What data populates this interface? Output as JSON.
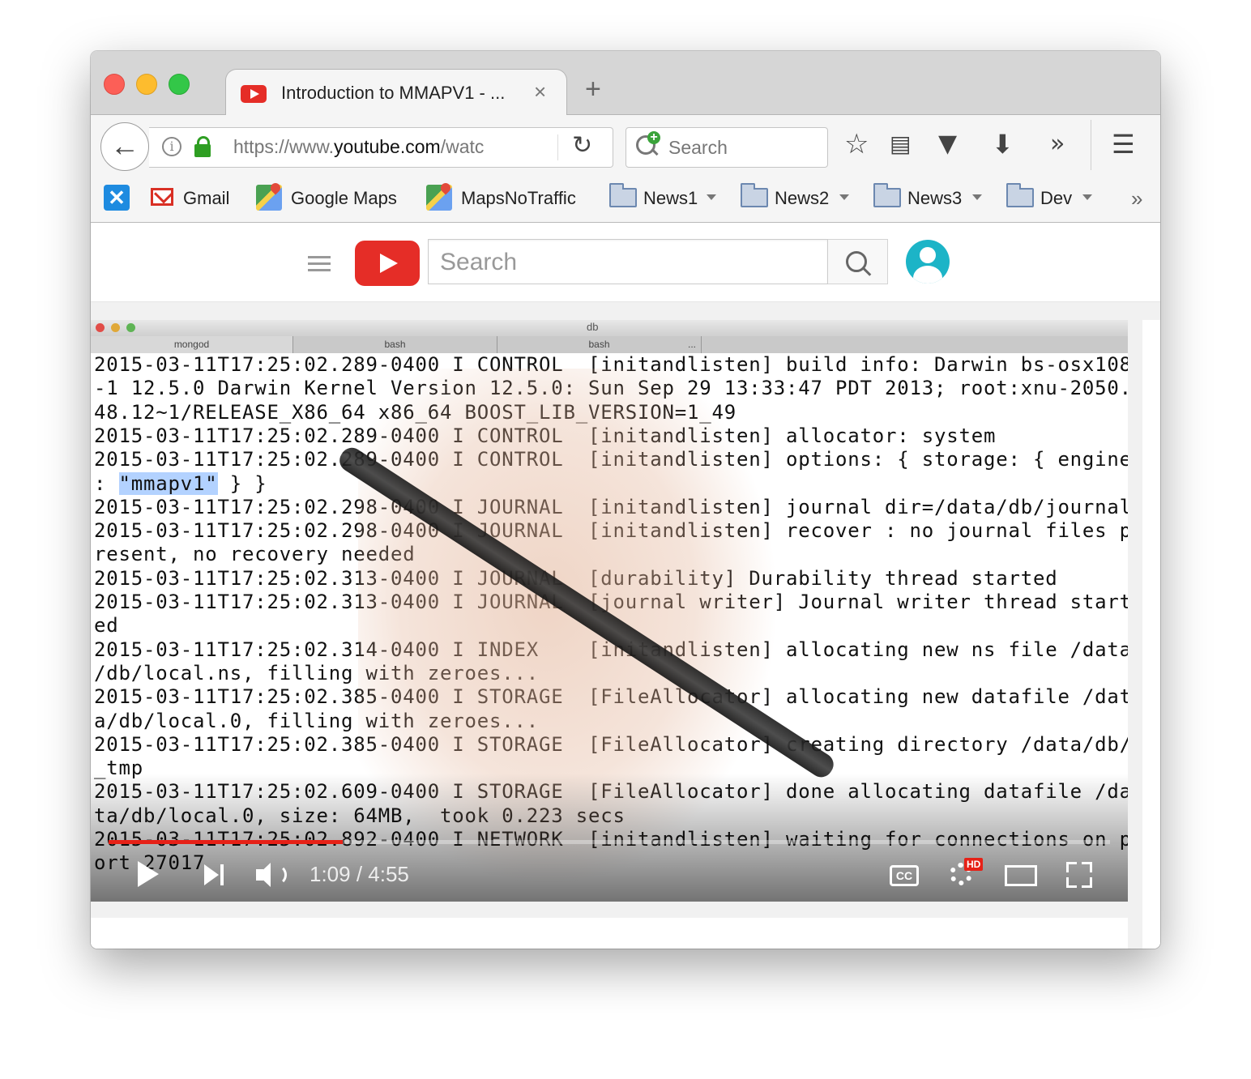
{
  "browser": {
    "tab": {
      "title": "Introduction to MMAPV1 - ...",
      "close_label": "×",
      "new_tab_label": "+"
    },
    "nav": {
      "url_prefix": "https://www.",
      "url_domain": "youtube.com",
      "url_suffix": "/watc",
      "search_placeholder": "Search"
    },
    "toolbar_icons": [
      "star-icon",
      "reading-list-icon",
      "pocket-icon",
      "download-icon",
      "overflow-icon",
      "menu-icon"
    ],
    "bookmarks": [
      {
        "label": "Gmail",
        "icon": "gmail-icon"
      },
      {
        "label": "Google Maps",
        "icon": "maps-icon"
      },
      {
        "label": "MapsNoTraffic",
        "icon": "maps-icon"
      },
      {
        "label": "News1",
        "icon": "folder-icon"
      },
      {
        "label": "News2",
        "icon": "folder-icon"
      },
      {
        "label": "News3",
        "icon": "folder-icon"
      },
      {
        "label": "Dev",
        "icon": "folder-icon"
      }
    ]
  },
  "youtube": {
    "search_placeholder": "Search"
  },
  "video": {
    "terminal": {
      "window_title": "db",
      "tabs": [
        "mongod",
        "bash",
        "bash"
      ],
      "tab_more": "...",
      "lines": [
        "2015-03-11T17:25:02.289-0400 I CONTROL  [initandlisten] build info: Darwin bs-osx108",
        "-1 12.5.0 Darwin Kernel Version 12.5.0: Sun Sep 29 13:33:47 PDT 2013; root:xnu-2050.",
        "48.12~1/RELEASE_X86_64 x86_64 BOOST_LIB_VERSION=1_49",
        "2015-03-11T17:25:02.289-0400 I CONTROL  [initandlisten] allocator: system",
        "2015-03-11T17:25:02.289-0400 I CONTROL  [initandlisten] options: { storage: { engine",
        ": \"mmapv1\" } }",
        "2015-03-11T17:25:02.298-0400 I JOURNAL  [initandlisten] journal dir=/data/db/journal",
        "2015-03-11T17:25:02.298-0400 I JOURNAL  [initandlisten] recover : no journal files p",
        "resent, no recovery needed",
        "2015-03-11T17:25:02.313-0400 I JOURNAL  [durability] Durability thread started",
        "2015-03-11T17:25:02.313-0400 I JOURNAL  [journal writer] Journal writer thread start",
        "ed",
        "2015-03-11T17:25:02.314-0400 I INDEX    [initandlisten] allocating new ns file /data",
        "/db/local.ns, filling with zeroes...",
        "2015-03-11T17:25:02.385-0400 I STORAGE  [FileAllocator] allocating new datafile /dat",
        "a/db/local.0, filling with zeroes...",
        "2015-03-11T17:25:02.385-0400 I STORAGE  [FileAllocator] creating directory /data/db/",
        "_tmp",
        "2015-03-11T17:25:02.609-0400 I STORAGE  [FileAllocator] done allocating datafile /da",
        "ta/db/local.0, size: 64MB,  took 0.223 secs",
        "2015-03-11T17:25:02.892-0400 I NETWORK  [initandlisten] waiting for connections on p",
        "ort 27017"
      ],
      "highlight_line_prefix": ": ",
      "highlight_text": "\"mmapv1\"",
      "highlight_line_suffix": " } }"
    },
    "player": {
      "time_display": "1:09 / 4:55",
      "progress_fraction": 0.234,
      "cc_label": "CC",
      "hd_badge": "HD"
    }
  }
}
